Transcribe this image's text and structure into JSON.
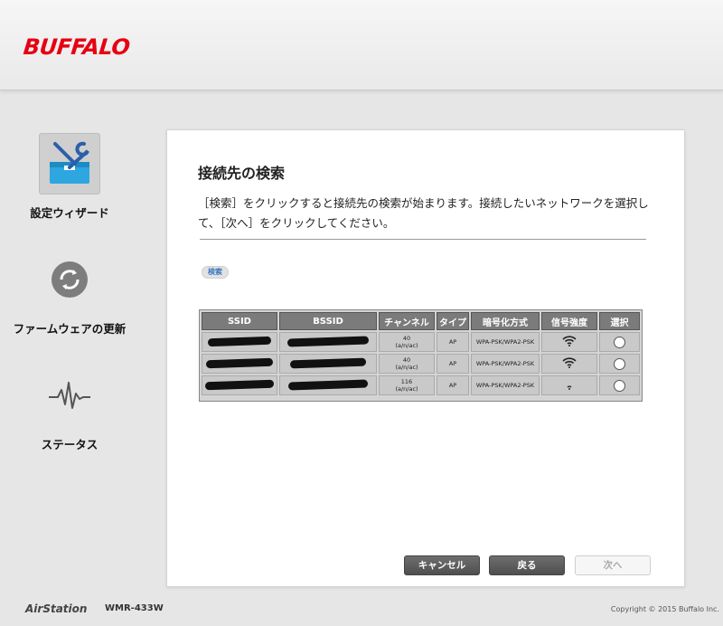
{
  "brand": {
    "logo": "BUFFALO"
  },
  "sidebar": {
    "items": [
      {
        "label": "設定ウィザード",
        "icon": "toolbox-icon",
        "active": true
      },
      {
        "label": "ファームウェアの更新",
        "icon": "refresh-icon",
        "active": false
      },
      {
        "label": "ステータス",
        "icon": "pulse-icon",
        "active": false
      }
    ]
  },
  "main": {
    "title": "接続先の検索",
    "description": "［検索］をクリックすると接続先の検索が始まります。接続したいネットワークを選択して、［次へ］をクリックしてください。",
    "search_button": "検索",
    "table": {
      "headers": [
        "SSID",
        "BSSID",
        "チャンネル",
        "タイプ",
        "暗号化方式",
        "信号強度",
        "選択"
      ],
      "rows": [
        {
          "channel": "40",
          "channel_mode": "(a/n/ac)",
          "type": "AP",
          "encryption": "WPA-PSK/WPA2-PSK",
          "signal": 3
        },
        {
          "channel": "40",
          "channel_mode": "(a/n/ac)",
          "type": "AP",
          "encryption": "WPA-PSK/WPA2-PSK",
          "signal": 3
        },
        {
          "channel": "116",
          "channel_mode": "(a/n/ac)",
          "type": "AP",
          "encryption": "WPA-PSK/WPA2-PSK",
          "signal": 1
        }
      ]
    },
    "buttons": {
      "cancel": "キャンセル",
      "back": "戻る",
      "next": "次へ"
    }
  },
  "footer": {
    "product": "AirStation",
    "model": "WMR-433W",
    "copyright": "Copyright © 2015 Buffalo Inc."
  },
  "colors": {
    "brand_red": "#e60012",
    "accent_blue": "#3a78c3"
  }
}
